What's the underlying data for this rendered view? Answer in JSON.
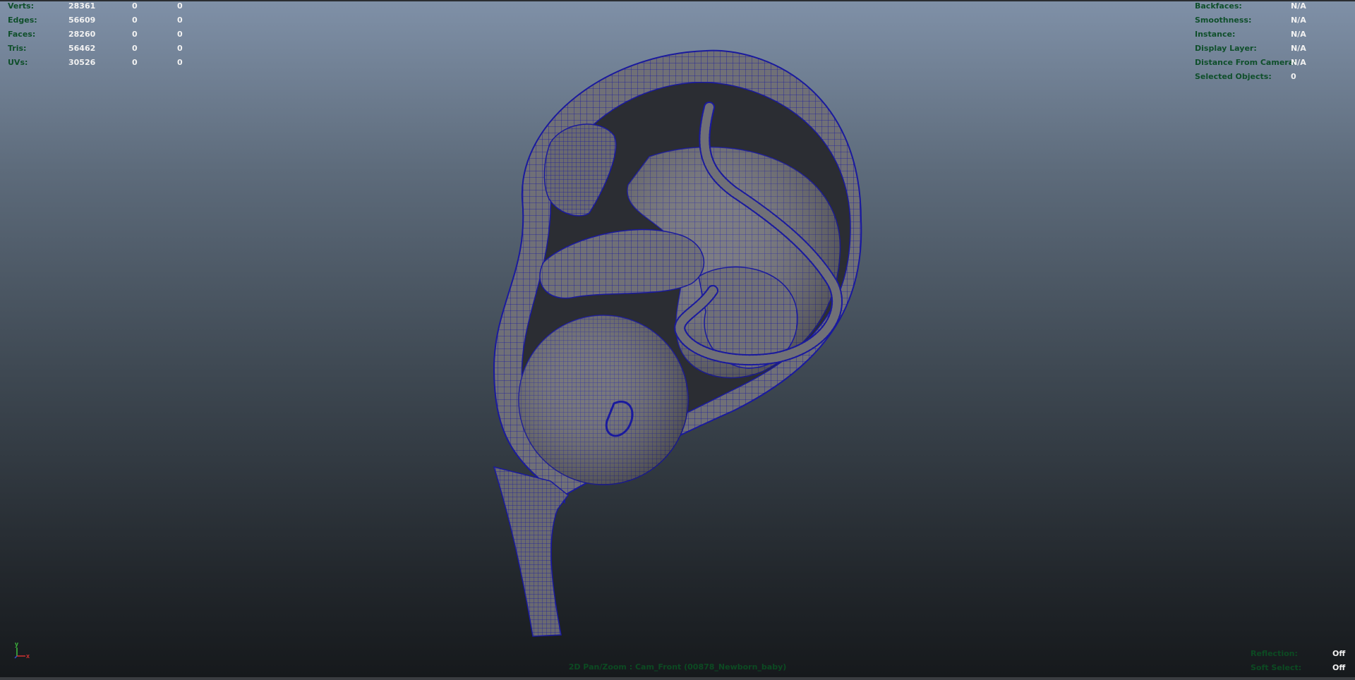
{
  "hud_left": {
    "rows": [
      {
        "label": "Verts:",
        "v1": "28361",
        "v2": "0",
        "v3": "0"
      },
      {
        "label": "Edges:",
        "v1": "56609",
        "v2": "0",
        "v3": "0"
      },
      {
        "label": "Faces:",
        "v1": "28260",
        "v2": "0",
        "v3": "0"
      },
      {
        "label": "Tris:",
        "v1": "56462",
        "v2": "0",
        "v3": "0"
      },
      {
        "label": "UVs:",
        "v1": "30526",
        "v2": "0",
        "v3": "0"
      }
    ]
  },
  "hud_right": {
    "rows": [
      {
        "label": "Backfaces:",
        "value": "N/A"
      },
      {
        "label": "Smoothness:",
        "value": "N/A"
      },
      {
        "label": "Instance:",
        "value": "N/A"
      },
      {
        "label": "Display Layer:",
        "value": "N/A"
      },
      {
        "label": "Distance From Camera:",
        "value": "N/A"
      },
      {
        "label": "Selected Objects:",
        "value": "0"
      }
    ]
  },
  "status": {
    "reflection_label": "Reflection:",
    "reflection_value": "Off",
    "soft_select_label": "Soft Select:",
    "soft_select_value": "Off",
    "camera": "2D Pan/Zoom : Cam_Front (00878_Newborn_baby)"
  },
  "axis": {
    "y": "y",
    "x": "x"
  },
  "colors": {
    "wireframe": "#1a1a9e",
    "mesh_fill": "#6f6f74",
    "hud_label": "#0f4f2b",
    "hud_value": "#f2f2f2"
  }
}
